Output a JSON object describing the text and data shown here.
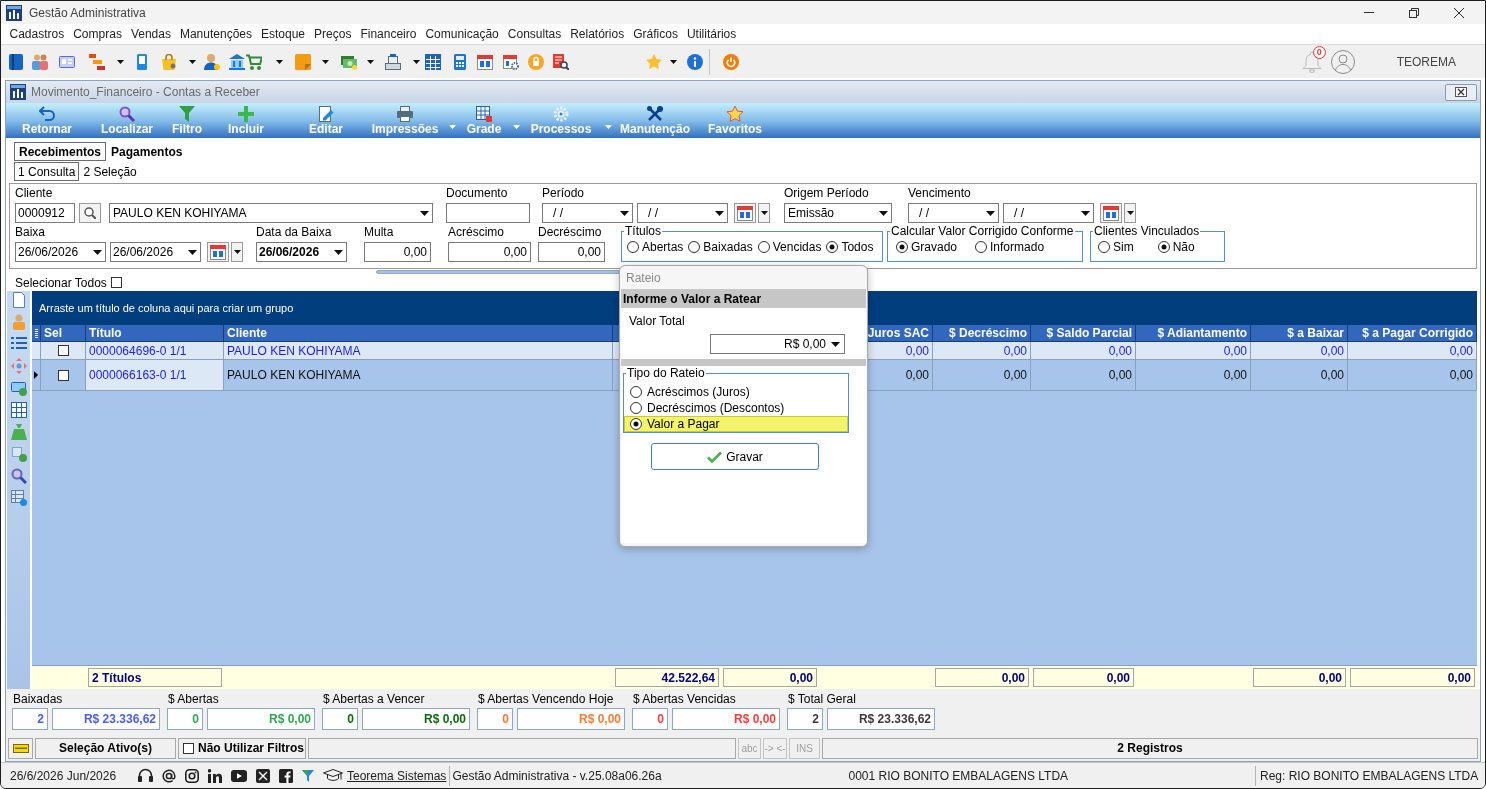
{
  "app_window": {
    "title": "Gestão Administrativa"
  },
  "menu": [
    "Cadastros",
    "Compras",
    "Vendas",
    "Manutenções",
    "Estoque",
    "Preços",
    "Financeiro",
    "Comunicação",
    "Consultas",
    "Relatórios",
    "Gráficos",
    "Utilitários"
  ],
  "user_area": {
    "notifications": "0",
    "user": "TEOREMA"
  },
  "document_window": {
    "title": "Movimento_Financeiro - Contas a Receber"
  },
  "ribbon": [
    {
      "label": "Retornar",
      "dropdown": false
    },
    {
      "label": "Localizar",
      "dropdown": false
    },
    {
      "label": "Filtro",
      "dropdown": false
    },
    {
      "label": "Incluir",
      "dropdown": false
    },
    {
      "label": "Editar",
      "dropdown": false
    },
    {
      "label": "Impressões",
      "dropdown": true
    },
    {
      "label": "Grade",
      "dropdown": true
    },
    {
      "label": "Processos",
      "dropdown": true
    },
    {
      "label": "Manutenção",
      "dropdown": false
    },
    {
      "label": "Favoritos",
      "dropdown": false
    }
  ],
  "tabs": [
    {
      "label": "Recebimentos",
      "selected": true
    },
    {
      "label": "Pagamentos",
      "selected": false
    }
  ],
  "subtabs": [
    {
      "label": "1 Consulta",
      "selected": true
    },
    {
      "label": "2 Seleção",
      "selected": false
    }
  ],
  "filters": {
    "cliente": {
      "label": "Cliente",
      "code": "0000912",
      "name": "PAULO KEN KOHIYAMA"
    },
    "documento": {
      "label": "Documento"
    },
    "periodo": {
      "label": "Período",
      "from": "/ /",
      "to": "/ /"
    },
    "origem_periodo": {
      "label": "Origem Período",
      "value": "Emissão"
    },
    "vencimento": {
      "label": "Vencimento",
      "from": "/ /",
      "to": "/ /"
    },
    "baixa": {
      "label": "Baixa",
      "from": "26/06/2026",
      "to": "26/06/2026"
    },
    "data_da_baixa": {
      "label": "Data da Baixa",
      "value": "26/06/2026"
    },
    "multa": {
      "label": "Multa",
      "value": "0,00"
    },
    "acrescimo": {
      "label": "Acréscimo",
      "value": "0,00"
    },
    "decrescimo": {
      "label": "Decréscimo",
      "value": "0,00"
    },
    "titulos": {
      "label": "Títulos",
      "options": [
        {
          "label": "Abertas",
          "selected": false
        },
        {
          "label": "Baixadas",
          "selected": false
        },
        {
          "label": "Vencidas",
          "selected": false
        },
        {
          "label": "Todos",
          "selected": true
        }
      ]
    },
    "calcular": {
      "label": "Calcular Valor Corrigido Conforme",
      "options": [
        {
          "label": "Gravado",
          "selected": true
        },
        {
          "label": "Informado",
          "selected": false
        }
      ]
    },
    "clientes_vinculados": {
      "label": "Clientes Vinculados",
      "options": [
        {
          "label": "Sim",
          "selected": false
        },
        {
          "label": "Não",
          "selected": true
        }
      ]
    }
  },
  "select_all": {
    "label": "Selecionar Todos",
    "checked": false
  },
  "grid": {
    "group_hint": "Arraste um título de coluna aqui para criar um grupo",
    "columns": {
      "sel": "Sel",
      "titulo": "Título",
      "cliente": "Cliente",
      "juros_sac": "Juros SAC",
      "decrescimo": "$ Decréscimo",
      "saldo_parcial": "$ Saldo Parcial",
      "adiantamento": "$ Adiantamento",
      "a_baixar": "$ a Baixar",
      "a_pagar_corrigido": "$ a Pagar Corrigido"
    },
    "rows": [
      {
        "selected": false,
        "checked": false,
        "titulo": "0000064696-0 1/1",
        "cliente": "PAULO KEN KOHIYAMA",
        "juros_sac": "0,00",
        "decrescimo": "0,00",
        "saldo_parcial": "0,00",
        "adiantamento": "0,00",
        "a_baixar": "0,00",
        "a_pagar_corrigido": "0,00"
      },
      {
        "selected": true,
        "checked": false,
        "titulo": "0000066163-0 1/1",
        "cliente": "PAULO KEN KOHIYAMA",
        "juros_sac": "0,00",
        "decrescimo": "0,00",
        "saldo_parcial": "0,00",
        "adiantamento": "0,00",
        "a_baixar": "0,00",
        "a_pagar_corrigido": "0,00"
      }
    ],
    "summary": {
      "titulo": "2 Títulos",
      "column_5": "42.522,64",
      "column_6": "0,00",
      "decrescimo": "0,00",
      "saldo_parcial": "0,00",
      "a_baixar": "0,00",
      "a_pagar_corrigido": "0,00"
    }
  },
  "totals": [
    {
      "label": "Baixadas",
      "count": "2",
      "amount": "R$ 23.336,62",
      "color": "#4b5cf0"
    },
    {
      "label": "$ Abertas",
      "count": "0",
      "amount": "R$ 0,00",
      "color": "#2fa84f"
    },
    {
      "label": "$ Abertas a Vencer",
      "count": "0",
      "amount": "R$ 0,00",
      "color": "#0b6b0b"
    },
    {
      "label": "$ Abertas Vencendo Hoje",
      "count": "0",
      "amount": "R$ 0,00",
      "color": "#ff7b33"
    },
    {
      "label": "$ Abertas Vencidas",
      "count": "0",
      "amount": "R$ 0,00",
      "color": "#ff3d3d"
    },
    {
      "label": "$ Total Geral",
      "count": "2",
      "amount": "R$ 23.336,62",
      "color": "#3a3a3a"
    }
  ],
  "status_bar": {
    "selection": "Seleção Ativo(s)",
    "no_filters": {
      "label": "Não Utilizar Filtros",
      "checked": false
    },
    "indicators": [
      {
        "label": "abc",
        "on": false
      },
      {
        "label": "-> <-",
        "on": false
      },
      {
        "label": "INS",
        "on": false
      }
    ],
    "records": "2 Registros"
  },
  "footer": {
    "date": "26/6/2026 Jun/2026",
    "link": "Teorema Sistemas",
    "version": "Gestão Administrativa - v.25.08a06.26a",
    "company": "0001 RIO BONITO EMBALAGENS LTDA",
    "registration": "Reg: RIO BONITO EMBALAGENS LTDA"
  },
  "dialog": {
    "title": "Rateio",
    "section": "Informe o Valor a Ratear",
    "valor_total": {
      "label": "Valor Total",
      "value": "R$ 0,00"
    },
    "tipo_do_rateio": {
      "label": "Tipo do Rateio",
      "options": [
        {
          "label": "Acréscimos (Juros)",
          "selected": false
        },
        {
          "label": "Decréscimos (Descontos)",
          "selected": false
        },
        {
          "label": "Valor a Pagar",
          "selected": true
        }
      ]
    },
    "button": "Gravar"
  }
}
